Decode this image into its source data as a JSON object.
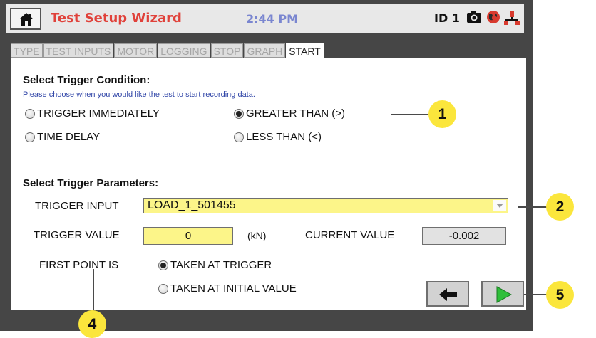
{
  "window": {
    "title": "Test Setup Wizard",
    "time": "2:44 PM",
    "id_label": "ID 1",
    "icons": [
      "home-icon",
      "camera-icon",
      "globe-icon",
      "network-icon"
    ]
  },
  "tabs": [
    "TYPE",
    "TEST INPUTS",
    "MOTOR",
    "LOGGING",
    "STOP",
    "GRAPH",
    "START"
  ],
  "active_tab": "START",
  "trigger_condition": {
    "heading": "Select Trigger Condition:",
    "hint": "Please choose when you would like the test to start recording data.",
    "options": [
      "TRIGGER IMMEDIATELY",
      "GREATER THAN (>)",
      "TIME DELAY",
      "LESS THAN (<)"
    ],
    "selected": "GREATER THAN (>)"
  },
  "trigger_parameters": {
    "heading": "Select Trigger Parameters:",
    "input_label": "TRIGGER INPUT",
    "input_value": "LOAD_1_501455",
    "value_label": "TRIGGER VALUE",
    "value": "0",
    "unit": "(kN)",
    "current_label": "CURRENT VALUE",
    "current_value": "-0.002",
    "first_point_label": "FIRST POINT IS",
    "first_point_options": [
      "TAKEN AT TRIGGER",
      "TAKEN AT INITIAL VALUE"
    ],
    "first_point_selected": "TAKEN AT TRIGGER"
  },
  "nav": {
    "back_icon": "arrow-left-icon",
    "next_icon": "play-icon"
  },
  "callouts": [
    "1",
    "2",
    "4",
    "5"
  ],
  "colors": {
    "title_red": "#e0413a",
    "clock_blue": "#7a86d0",
    "input_yellow": "#fcf589",
    "callout_yellow": "#fbe63c",
    "next_green": "#2fbf3a"
  }
}
